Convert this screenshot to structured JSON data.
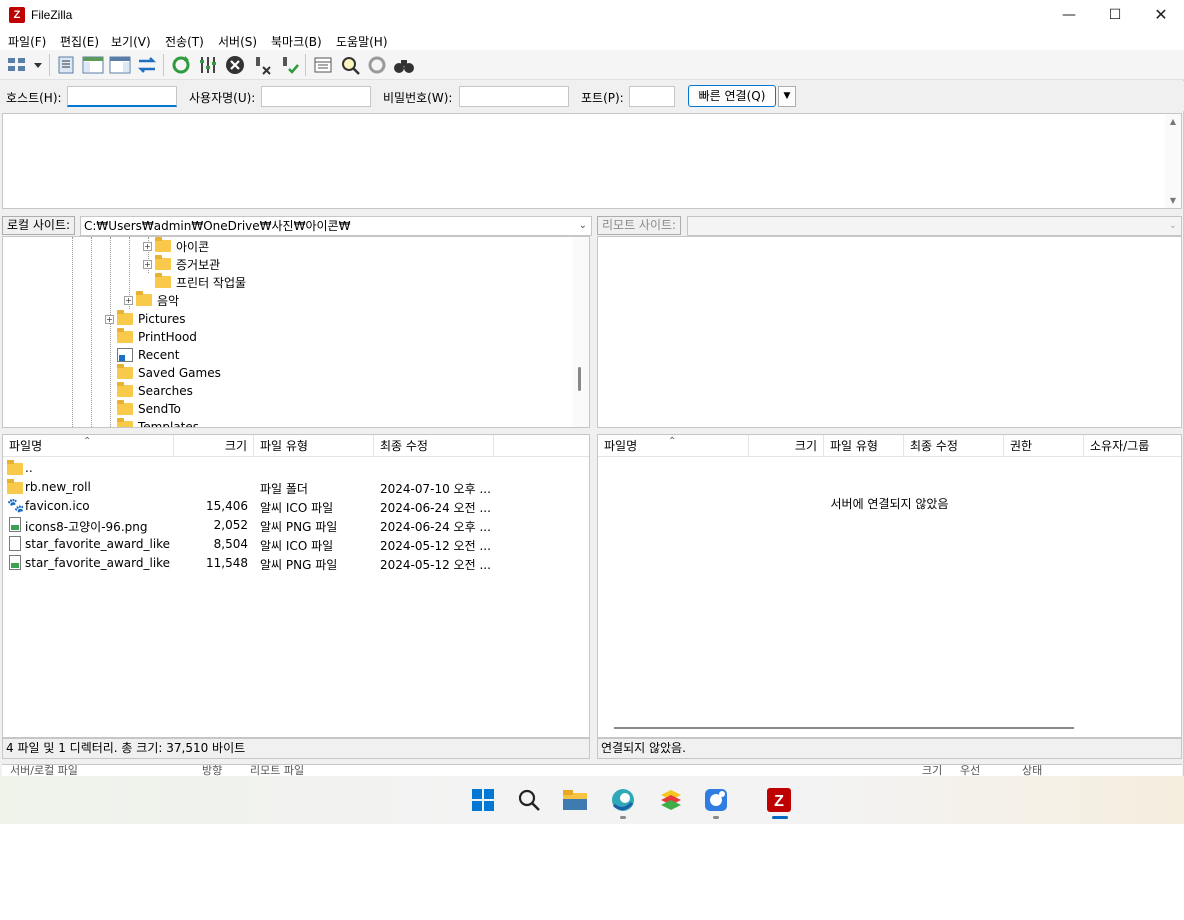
{
  "window": {
    "title": "FileZilla",
    "logo_text": "Z"
  },
  "menu": [
    "파일(F)",
    "편집(E)",
    "보기(V)",
    "전송(T)",
    "서버(S)",
    "북마크(B)",
    "도움말(H)"
  ],
  "toolbar_icons": [
    "site-manager-icon",
    "toggle-log-icon",
    "toggle-local-tree-icon",
    "toggle-remote-tree-icon",
    "toggle-queue-icon",
    "refresh-icon",
    "process-queue-icon",
    "cancel-icon",
    "disconnect-icon",
    "reconnect-icon",
    "filter-icon",
    "compare-icon",
    "sync-browse-icon",
    "search-icon"
  ],
  "quickconnect": {
    "host_label": "호스트(H):",
    "user_label": "사용자명(U):",
    "pass_label": "비밀번호(W):",
    "port_label": "포트(P):",
    "host_value": "",
    "user_value": "",
    "pass_value": "",
    "port_value": "",
    "button": "빠른 연결(Q)",
    "dropdown": "▼"
  },
  "local": {
    "site_label": "로컬 사이트:",
    "path": "C:₩Users₩admin₩OneDrive₩사진₩아이콘₩",
    "tree": [
      {
        "label": "아이콘",
        "expander": true
      },
      {
        "label": "증거보관",
        "expander": true
      },
      {
        "label": "프린터 작업물",
        "expander": false
      },
      {
        "label": "음악",
        "expander": true
      },
      {
        "label": "Pictures",
        "expander": true
      },
      {
        "label": "PrintHood",
        "expander": false
      },
      {
        "label": "Recent",
        "expander": false
      },
      {
        "label": "Saved Games",
        "expander": false
      },
      {
        "label": "Searches",
        "expander": false
      },
      {
        "label": "SendTo",
        "expander": false
      },
      {
        "label": "Templates",
        "expander": false
      }
    ],
    "columns": [
      "파일명",
      "크기",
      "파일 유형",
      "최종 수정"
    ],
    "files": [
      {
        "name": "..",
        "size": "",
        "type": "",
        "modified": "",
        "icon": "folder-icon"
      },
      {
        "name": "rb.new_roll",
        "size": "",
        "type": "파일 폴더",
        "modified": "2024-07-10 오후 ...",
        "icon": "folder-icon"
      },
      {
        "name": "favicon.ico",
        "size": "15,406",
        "type": "알씨 ICO 파일",
        "modified": "2024-06-24 오전 ...",
        "icon": "paw-icon"
      },
      {
        "name": "icons8-고양이-96.png",
        "size": "2,052",
        "type": "알씨 PNG 파일",
        "modified": "2024-06-24 오후 ...",
        "icon": "png-file-icon"
      },
      {
        "name": "star_favorite_award_like_i...",
        "size": "8,504",
        "type": "알씨 ICO 파일",
        "modified": "2024-05-12 오전 ...",
        "icon": "file-icon"
      },
      {
        "name": "star_favorite_award_like_i...",
        "size": "11,548",
        "type": "알씨 PNG 파일",
        "modified": "2024-05-12 오전 ...",
        "icon": "png-file-icon"
      }
    ],
    "status": "4 파일 및 1 디렉터리. 총 크기: 37,510 바이트"
  },
  "remote": {
    "site_label": "리모트 사이트:",
    "path": "",
    "columns": [
      "파일명",
      "크기",
      "파일 유형",
      "최종 수정",
      "권한",
      "소유자/그룹"
    ],
    "empty_message": "서버에 연결되지 않았음",
    "status": "연결되지 않았음."
  },
  "queue_columns": [
    "서버/로컬 파일",
    "방향",
    "리모트 파일",
    "크기",
    "우선",
    "상태"
  ],
  "taskbar": [
    "start-icon",
    "search-icon",
    "file-explorer-icon",
    "browser-icon",
    "bluestacks-icon",
    "messenger-icon",
    "filezilla-icon"
  ]
}
